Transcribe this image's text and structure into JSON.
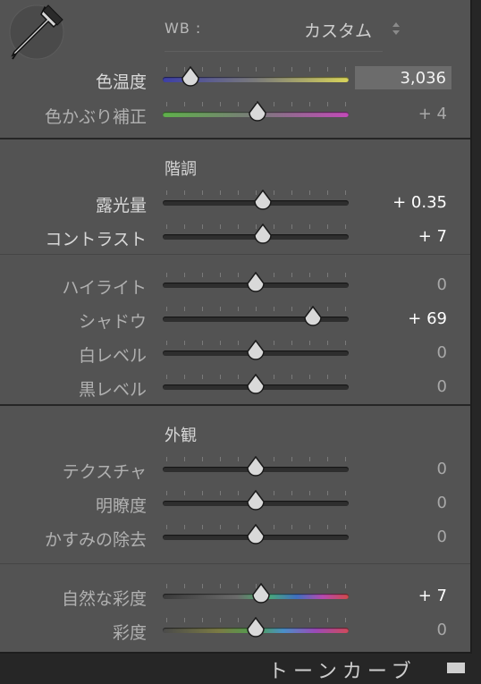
{
  "wb": {
    "label": "WB :",
    "value": "カスタム"
  },
  "basic": {
    "temp": {
      "label": "色温度",
      "value": "3,036",
      "level": 0.15,
      "gradient": [
        "#3d3fa6",
        "#d8d45a"
      ]
    },
    "tint": {
      "label": "色かぶり補正",
      "value": "+ 4",
      "level": 0.51,
      "gradient": [
        "#5fb04a",
        "#c24ab8"
      ]
    }
  },
  "tone": {
    "title": "階調",
    "rows": [
      {
        "label": "露光量",
        "value": "+ 0.35",
        "level": 0.54
      },
      {
        "label": "コントラスト",
        "value": "+ 7",
        "level": 0.54
      }
    ]
  },
  "tone2": {
    "rows": [
      {
        "label": "ハイライト",
        "value": "0",
        "level": 0.5
      },
      {
        "label": "シャドウ",
        "value": "+ 69",
        "level": 0.81
      },
      {
        "label": "白レベル",
        "value": "0",
        "level": 0.5
      },
      {
        "label": "黒レベル",
        "value": "0",
        "level": 0.5
      }
    ]
  },
  "presence": {
    "title": "外観",
    "rows": [
      {
        "label": "テクスチャ",
        "value": "0",
        "level": 0.5
      },
      {
        "label": "明瞭度",
        "value": "0",
        "level": 0.5
      },
      {
        "label": "かすみの除去",
        "value": "0",
        "level": 0.5
      }
    ]
  },
  "saturation": {
    "rows": [
      {
        "label": "自然な彩度",
        "value": "+ 7",
        "level": 0.53
      },
      {
        "label": "彩度",
        "value": "0",
        "level": 0.5
      }
    ]
  },
  "next_panel": {
    "label": "トーンカーブ"
  }
}
